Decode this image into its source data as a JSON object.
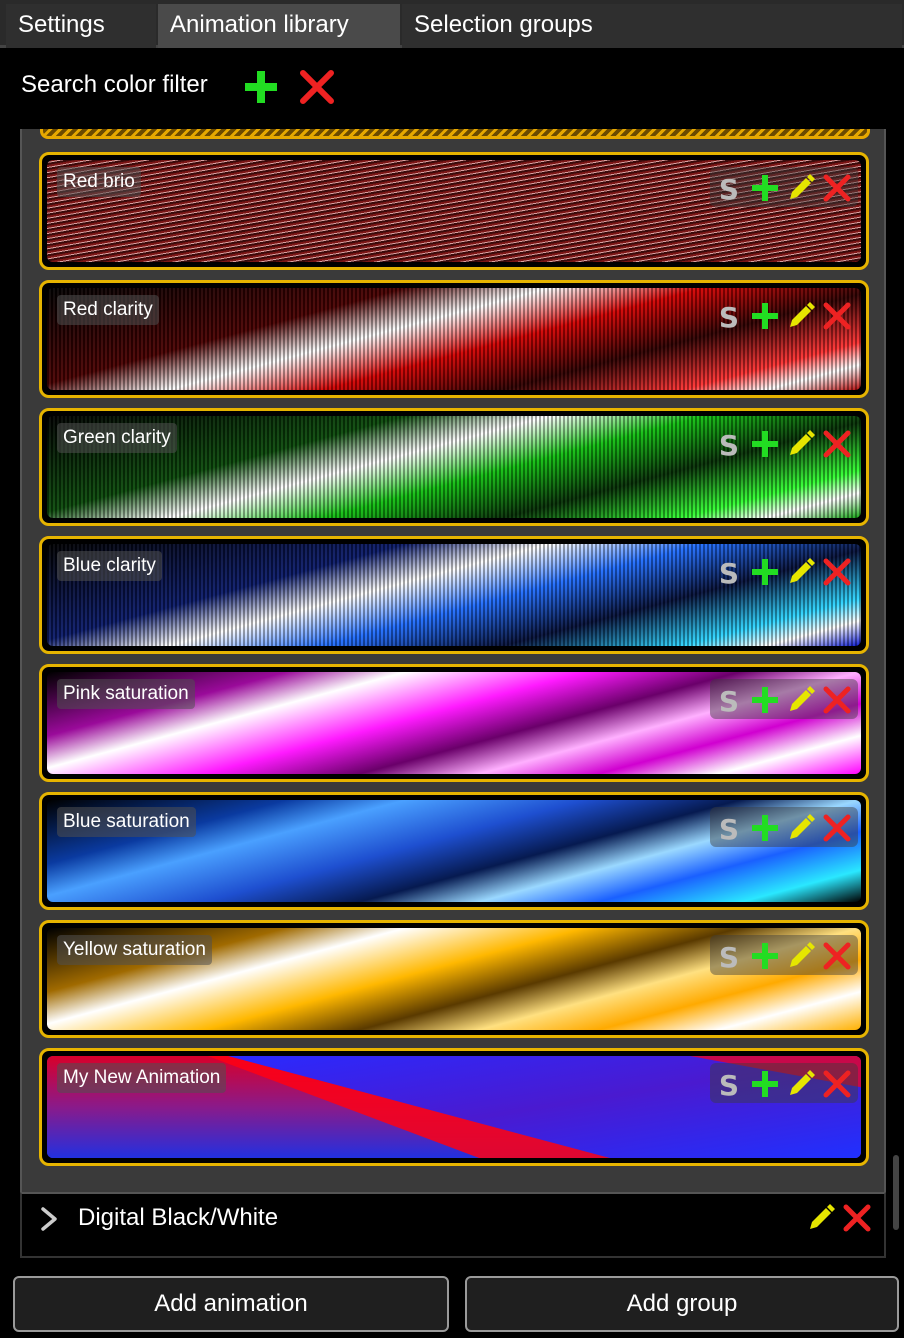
{
  "tabs": [
    {
      "label": "Settings",
      "active": false
    },
    {
      "label": "Animation library",
      "active": true
    },
    {
      "label": "Selection groups",
      "active": false
    }
  ],
  "search": {
    "label": "Search color filter",
    "add_icon": "plus-icon",
    "clear_icon": "close-icon"
  },
  "animations": [
    {
      "name": "Red brio"
    },
    {
      "name": "Red clarity"
    },
    {
      "name": "Green clarity"
    },
    {
      "name": "Blue clarity"
    },
    {
      "name": "Pink saturation"
    },
    {
      "name": "Blue saturation"
    },
    {
      "name": "Yellow saturation"
    },
    {
      "name": "My New Animation"
    }
  ],
  "tool_icons": [
    "s-icon",
    "plus-icon",
    "pencil-icon",
    "close-icon"
  ],
  "group": {
    "title": "Digital Black/White",
    "expanded": false
  },
  "buttons": {
    "add_animation": "Add animation",
    "add_group": "Add group"
  },
  "colors": {
    "accent_border": "#e6b400",
    "add_green": "#22dd22",
    "delete_red": "#ee2222",
    "edit_yellow": "#e6e600"
  }
}
